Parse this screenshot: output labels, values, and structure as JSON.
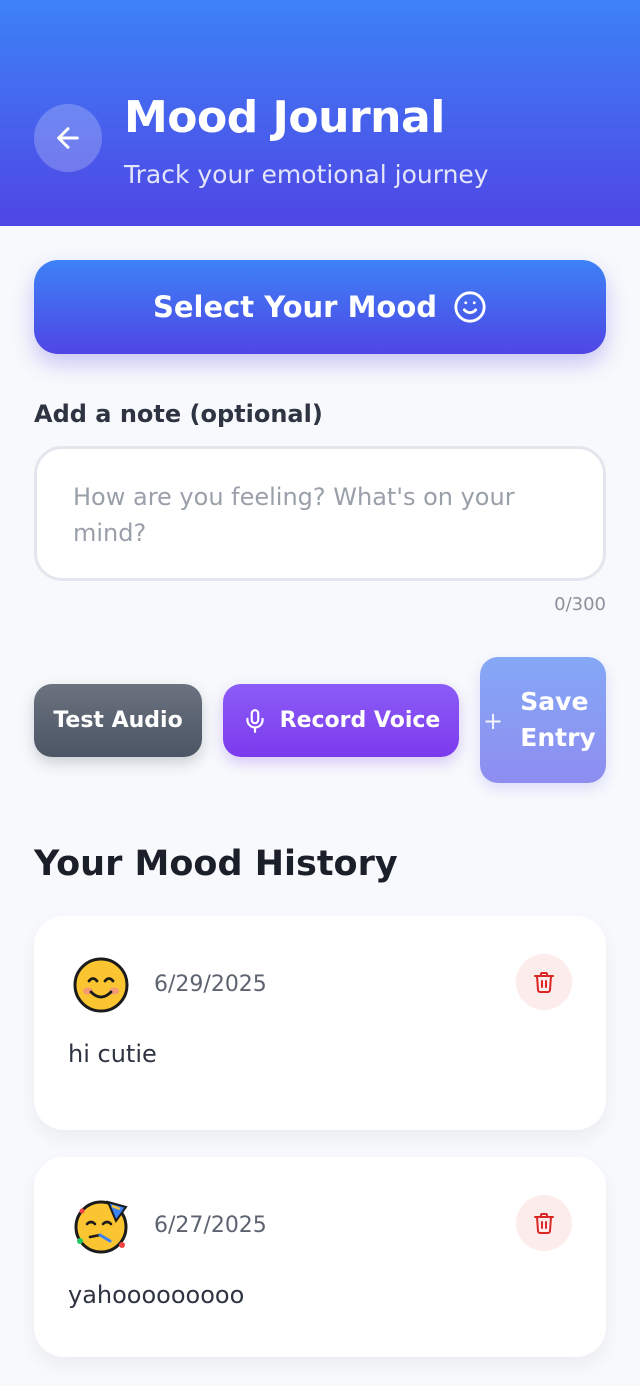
{
  "header": {
    "title": "Mood Journal",
    "subtitle": "Track your emotional journey",
    "back_icon": "arrow-left-icon"
  },
  "mood_selector": {
    "label": "Select Your Mood",
    "icon": "smiley-icon"
  },
  "note": {
    "label": "Add a note (optional)",
    "placeholder": "How are you feeling? What's on your mind?",
    "value": "",
    "counter": "0/300"
  },
  "actions": {
    "test_audio": "Test Audio",
    "record_voice": "Record Voice",
    "record_icon": "microphone-icon",
    "save_plus": "+",
    "save_line1": "Save",
    "save_line2": "Entry"
  },
  "history": {
    "title": "Your Mood History",
    "entries": [
      {
        "emoji": "smiling-face-icon",
        "date": "6/29/2025",
        "note": "hi cutie",
        "delete_icon": "trash-icon"
      },
      {
        "emoji": "party-face-icon",
        "date": "6/27/2025",
        "note": "yahooooooooo",
        "delete_icon": "trash-icon"
      }
    ]
  },
  "colors": {
    "header_start": "#3d82f6",
    "header_end": "#4f46e5",
    "record_purple": "#7c3aed",
    "test_gray": "#4b5563",
    "delete_red": "#dc2626"
  }
}
